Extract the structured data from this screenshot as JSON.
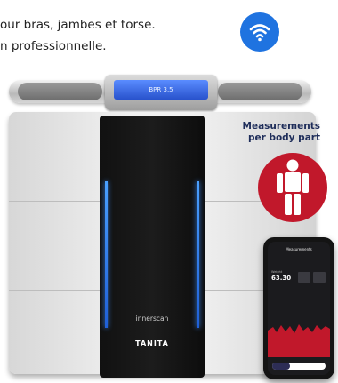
{
  "caption": {
    "line1": "our bras, jambes et torse.",
    "line2": "n professionnelle."
  },
  "device": {
    "display_text": "BPR 3.5",
    "brand_line": "innerscan",
    "brand_logo": "TANITA",
    "measure_label_line1": "Measurements",
    "measure_label_line2": "per body part"
  },
  "phone": {
    "header": "Measurements",
    "stat_label": "Weight",
    "stat_value": "63.30"
  },
  "icons": {
    "wifi": "wifi-icon",
    "body": "body-segments-icon"
  },
  "colors": {
    "wifi_blue": "#1f73e0",
    "accent_red": "#c1182b",
    "glow_blue": "#3a8cff"
  }
}
